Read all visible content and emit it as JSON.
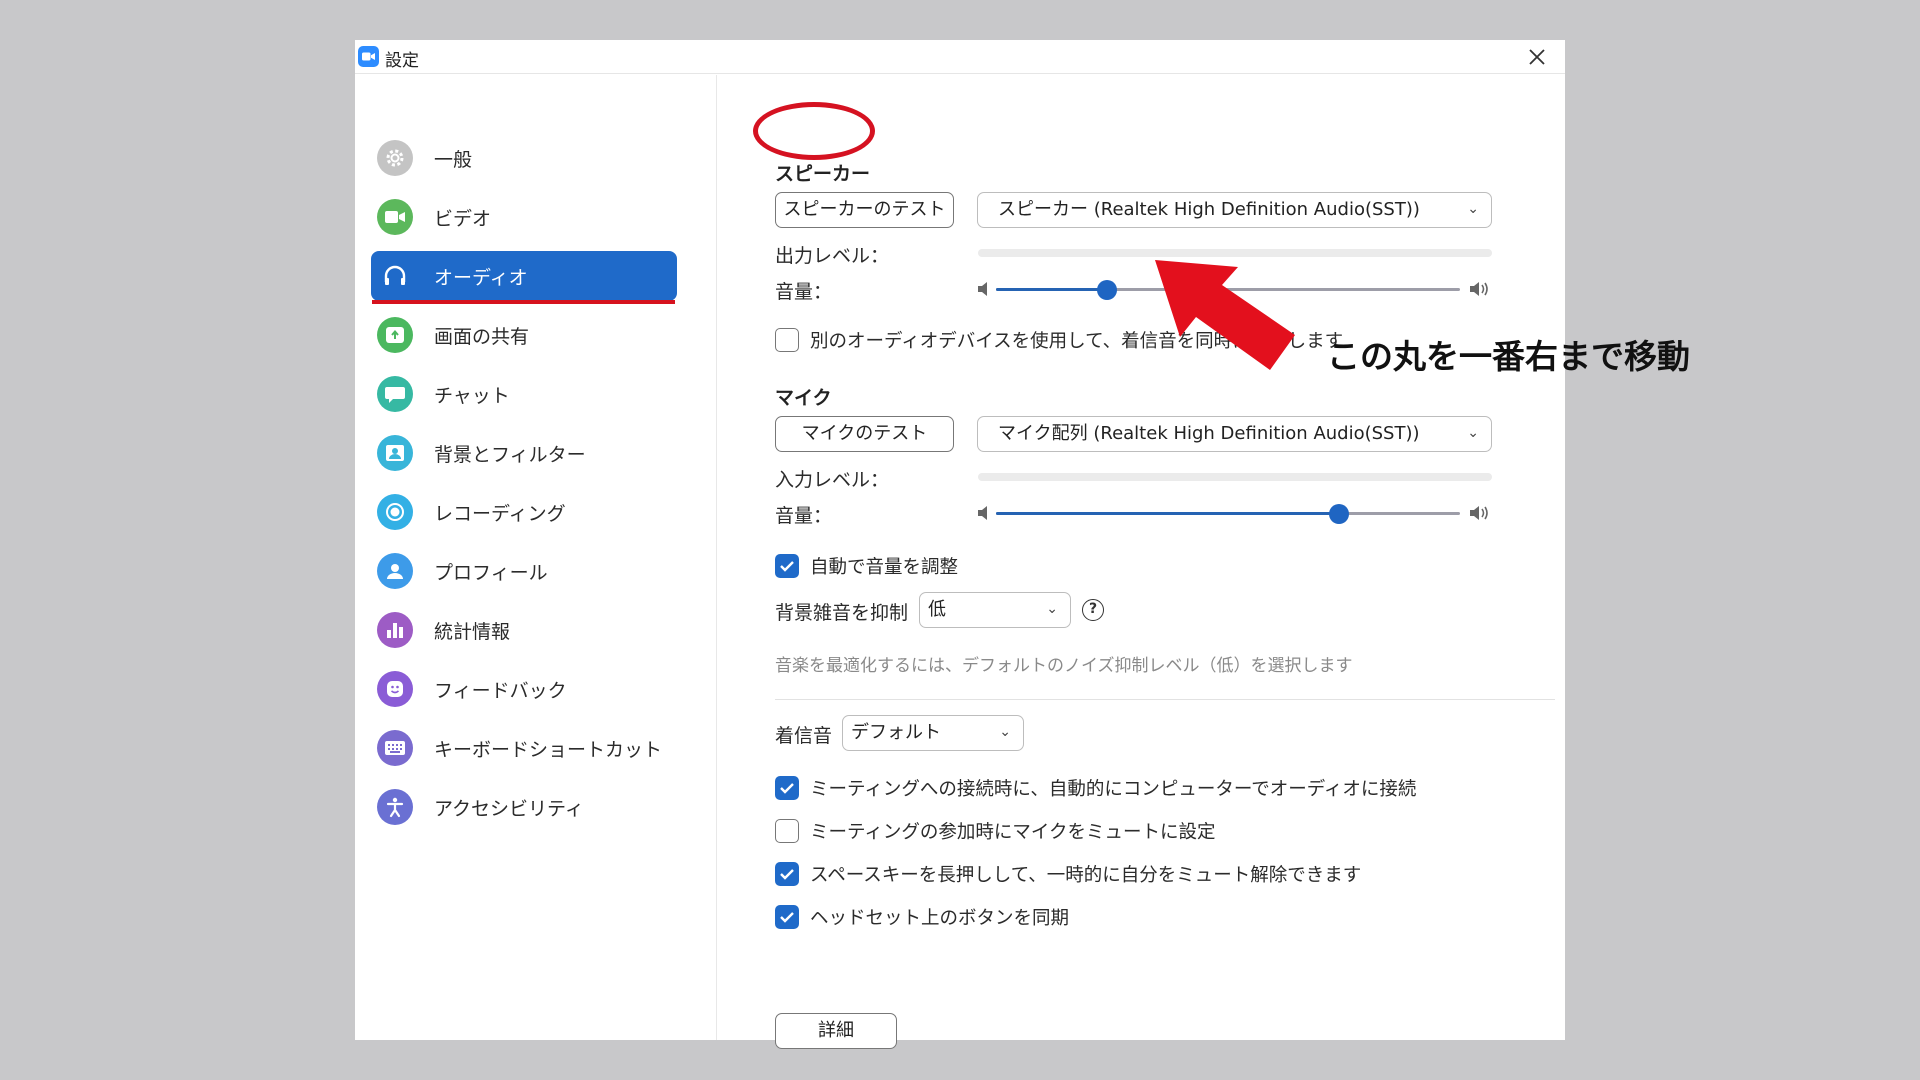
{
  "window": {
    "title": "設定"
  },
  "sidebar": {
    "items": [
      {
        "label": "一般",
        "icon": "gear-icon",
        "color": "#bfbfbf"
      },
      {
        "label": "ビデオ",
        "icon": "video-camera-icon",
        "color": "#5cb85c"
      },
      {
        "label": "オーディオ",
        "icon": "headphones-icon",
        "color": "#1f6ac9",
        "active": true
      },
      {
        "label": "画面の共有",
        "icon": "share-screen-icon",
        "color": "#4bb85f"
      },
      {
        "label": "チャット",
        "icon": "chat-bubble-icon",
        "color": "#36b9a3"
      },
      {
        "label": "背景とフィルター",
        "icon": "background-portrait-icon",
        "color": "#38b5d9"
      },
      {
        "label": "レコーディング",
        "icon": "record-icon",
        "color": "#33b0e5"
      },
      {
        "label": "プロフィール",
        "icon": "profile-icon",
        "color": "#3d9be9"
      },
      {
        "label": "統計情報",
        "icon": "statistics-icon",
        "color": "#9d5cc5"
      },
      {
        "label": "フィードバック",
        "icon": "smiley-icon",
        "color": "#8a5cd6"
      },
      {
        "label": "キーボードショートカット",
        "icon": "keyboard-icon",
        "color": "#7a6bcf"
      },
      {
        "label": "アクセシビリティ",
        "icon": "accessibility-icon",
        "color": "#6a70d3"
      }
    ]
  },
  "speaker": {
    "title": "スピーカー",
    "test_button": "スピーカーのテスト",
    "device": "スピーカー (Realtek High Definition Audio(SST))",
    "output_level_label": "出力レベル：",
    "volume_label": "音量：",
    "volume": 0.24
  },
  "separate_device_label": "別のオーディオデバイスを使用して、着信音を同時に鳴らします",
  "separate_device_checked": false,
  "mic": {
    "title": "マイク",
    "test_button": "マイクのテスト",
    "device": "マイク配列 (Realtek High Definition Audio(SST))",
    "input_level_label": "入力レベル：",
    "volume_label": "音量：",
    "volume": 0.74
  },
  "auto_adjust": {
    "label": "自動で音量を調整",
    "checked": true
  },
  "noise": {
    "label": "背景雑音を抑制",
    "value": "低",
    "hint": "音楽を最適化するには、デフォルトのノイズ抑制レベル（低）を選択します"
  },
  "ringtone": {
    "label": "着信音",
    "value": "デフォルト"
  },
  "options": [
    {
      "label": "ミーティングへの接続時に、自動的にコンピューターでオーディオに接続",
      "checked": true
    },
    {
      "label": "ミーティングの参加時にマイクをミュートに設定",
      "checked": false
    },
    {
      "label": "スペースキーを長押しして、一時的に自分をミュート解除できます",
      "checked": true
    },
    {
      "label": "ヘッドセット上のボタンを同期",
      "checked": true
    }
  ],
  "advanced_button": "詳細",
  "annotation": {
    "text": "この丸を一番右まで移動",
    "color": "#d51221"
  }
}
